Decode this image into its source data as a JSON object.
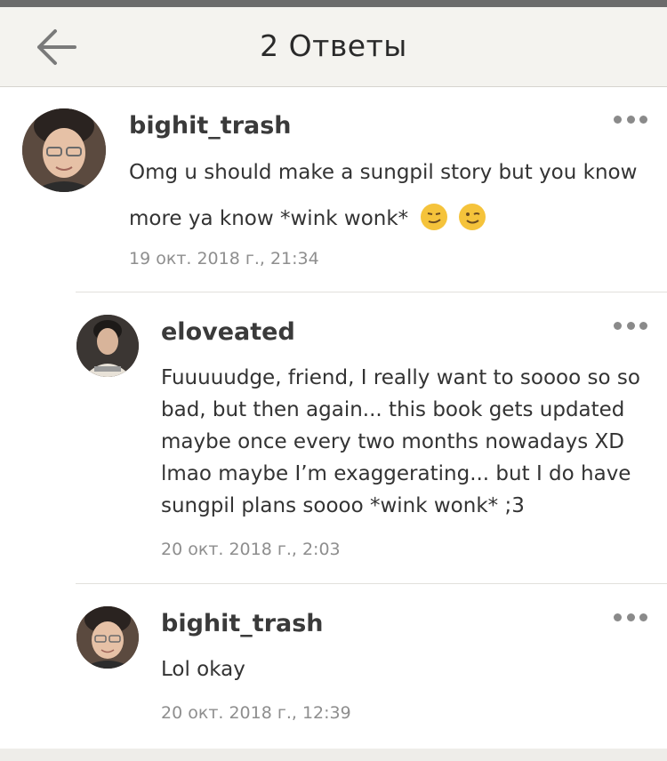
{
  "header": {
    "title": "2 Ответы",
    "back_icon": "arrow-left-icon"
  },
  "comments": [
    {
      "username": "bighit_trash",
      "text_line1": "Omg u should make a sungpil story but you know",
      "text_line2": "more ya know *wink wonk*",
      "emojis": [
        "smirking-face-emoji",
        "winking-face-emoji"
      ],
      "timestamp": "19 окт. 2018 г., 21:34",
      "more_icon": "more-horizontal-icon"
    },
    {
      "username": "eloveated",
      "lines": [
        "Fuuuuudge, friend, I really want to soooo so so",
        "bad, but then again... this book gets updated",
        "maybe once every two months nowadays XD",
        "lmao maybe I’m exaggerating... but I do have",
        "sungpil plans soooo *wink wonk* ;3"
      ],
      "timestamp": "20 окт. 2018 г., 2:03",
      "more_icon": "more-horizontal-icon"
    },
    {
      "username": "bighit_trash",
      "text": "Lol okay",
      "timestamp": "20 окт. 2018 г., 12:39",
      "more_icon": "more-horizontal-icon"
    }
  ],
  "colors": {
    "header_bg": "#f4f3ef",
    "text_primary": "#333333",
    "timestamp": "#8e8e8e",
    "more_dots": "#8a8a8a"
  }
}
